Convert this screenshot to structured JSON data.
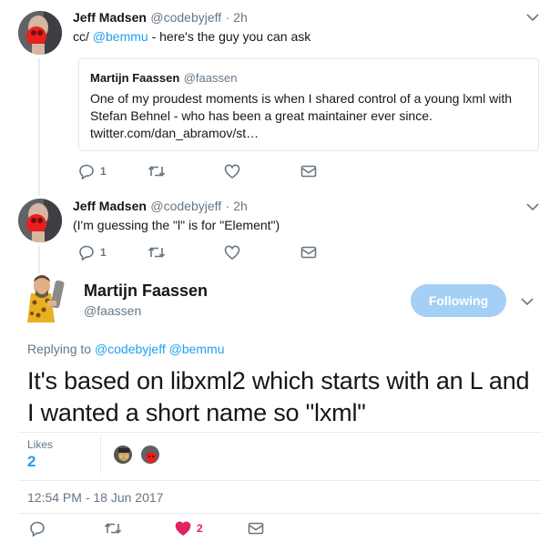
{
  "reply1": {
    "name": "Jeff Madsen",
    "handle": "@codebyjeff",
    "time": "· 2h",
    "text_prefix": "cc/ ",
    "mention": "@bemmu",
    "text_suffix": " - here's the guy you can ask",
    "quote": {
      "name": "Martijn Faassen",
      "handle": "@faassen",
      "text": "One of my proudest moments is when I shared control of a young lxml with Stefan Behnel - who has been a great maintainer ever since. twitter.com/dan_abramov/st…"
    },
    "actions": {
      "reply_count": "1"
    }
  },
  "reply2": {
    "name": "Jeff Madsen",
    "handle": "@codebyjeff",
    "time": "· 2h",
    "text": "(I'm guessing the \"l\" is for \"Element\")",
    "actions": {
      "reply_count": "1"
    }
  },
  "main": {
    "name": "Martijn Faassen",
    "handle": "@faassen",
    "follow_label": "Following",
    "replying_label": "Replying to ",
    "replying_mentions": "@codebyjeff @bemmu",
    "text": "It's based on libxml2 which starts with an L and I wanted a short name so \"lxml\"",
    "likes_label": "Likes",
    "likes_count": "2",
    "timestamp": "12:54 PM - 18 Jun 2017",
    "actions": {
      "like_count": "2"
    }
  },
  "colors": {
    "link": "#1da1f2",
    "like_red": "#e0245e",
    "follow_button": "#a5d0f5",
    "muted": "#657786"
  },
  "icons": [
    "reply-icon",
    "retweet-icon",
    "like-icon",
    "dm-icon",
    "chevron-down-icon"
  ]
}
